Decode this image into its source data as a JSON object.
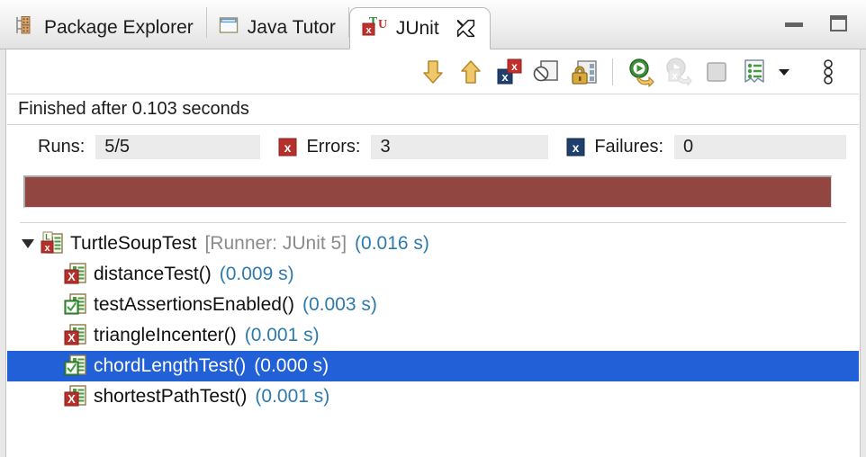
{
  "window": {
    "minimize_label": "Minimize",
    "maximize_label": "Maximize"
  },
  "tabs": [
    {
      "label": "Package Explorer",
      "icon": "package-explorer-icon",
      "active": false
    },
    {
      "label": "Java Tutor",
      "icon": "java-tutor-view-icon",
      "active": false
    },
    {
      "label": "JUnit",
      "icon": "junit-icon",
      "active": true,
      "closeable": true
    }
  ],
  "toolbar": {
    "buttons": [
      {
        "name": "next-failure-button",
        "label": "Next Failed Test",
        "icon": "arrow-down-icon"
      },
      {
        "name": "previous-failure-button",
        "label": "Previous Failed Test",
        "icon": "arrow-up-icon"
      },
      {
        "name": "show-failures-only-button",
        "label": "Show Failures Only",
        "icon": "failures-only-icon"
      },
      {
        "name": "show-ignored-only-button",
        "label": "Show Ignored Only",
        "icon": "ignored-only-icon"
      },
      {
        "name": "scroll-lock-button",
        "label": "Scroll Lock",
        "icon": "lock-icon"
      },
      {
        "name": "rerun-test-button",
        "label": "Rerun Test",
        "icon": "rerun-green-icon"
      },
      {
        "name": "rerun-failed-button",
        "label": "Rerun Test - Failures First",
        "icon": "rerun-failed-icon",
        "disabled": true
      },
      {
        "name": "stop-button",
        "label": "Stop JUnit Test Run",
        "icon": "stop-icon",
        "disabled": true
      },
      {
        "name": "test-run-history-button",
        "label": "Test Run History",
        "icon": "history-list-icon",
        "dropdown": true
      },
      {
        "name": "view-menu-button",
        "label": "View Menu",
        "icon": "view-menu-icon"
      }
    ]
  },
  "status": {
    "text": "Finished after 0.103 seconds"
  },
  "counters": {
    "runs_label": "Runs:",
    "runs_value": "5/5",
    "errors_label": "Errors:",
    "errors_value": "3",
    "errors_icon": "error-x-icon",
    "failures_label": "Failures:",
    "failures_value": "0",
    "failures_icon": "failure-x-icon"
  },
  "progress": {
    "percent": 100,
    "color": "#924641",
    "state": "failed"
  },
  "tree": {
    "rows": [
      {
        "name": "TurtleSoupTest",
        "runner": "[Runner: JUnit 5]",
        "time": "(0.016 s)",
        "level": 0,
        "expanded": true,
        "status": "error",
        "icon": "test-class-error-icon",
        "selected": false
      },
      {
        "name": "distanceTest()",
        "runner": "",
        "time": "(0.009 s)",
        "level": 1,
        "status": "error",
        "icon": "test-error-icon",
        "selected": false
      },
      {
        "name": "testAssertionsEnabled()",
        "runner": "",
        "time": "(0.003 s)",
        "level": 1,
        "status": "pass",
        "icon": "test-pass-icon",
        "selected": false
      },
      {
        "name": "triangleIncenter()",
        "runner": "",
        "time": "(0.001 s)",
        "level": 1,
        "status": "error",
        "icon": "test-error-icon",
        "selected": false
      },
      {
        "name": "chordLengthTest()",
        "runner": "",
        "time": "(0.000 s)",
        "level": 1,
        "status": "pass",
        "icon": "test-pass-icon",
        "selected": true
      },
      {
        "name": "shortestPathTest()",
        "runner": "",
        "time": "(0.001 s)",
        "level": 1,
        "status": "error",
        "icon": "test-error-icon",
        "selected": false
      }
    ]
  },
  "colors": {
    "progress_failed": "#924641",
    "selection": "#2160d7",
    "time_text": "#2d7aad",
    "runner_text": "#8b8b8b",
    "error_red": "#c1312b",
    "pass_green": "#3f9d3f"
  }
}
